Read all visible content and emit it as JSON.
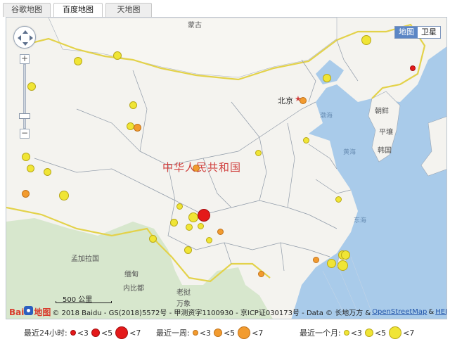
{
  "tabs": [
    {
      "label": "谷歌地图",
      "active": false
    },
    {
      "label": "百度地图",
      "active": true
    },
    {
      "label": "天地图",
      "active": false
    }
  ],
  "map_type": {
    "map_label": "地图",
    "satellite_label": "卫星"
  },
  "labels": {
    "mongolia": "蒙古",
    "china": "中华人民共和国",
    "beijing": "北京",
    "bohai": "渤海",
    "huanghai": "黄海",
    "donghai": "东海",
    "north_korea": "朝鲜",
    "pyongyang": "平壤",
    "korea": "韩国",
    "bangladesh": "孟加拉国",
    "myanmar": "缅甸",
    "naypyidaw": "内比都",
    "laos": "老挝",
    "vientiane": "万象"
  },
  "scale": {
    "text": "500 公里"
  },
  "copyright": {
    "logo_text": "Bai",
    "logo_suffix": "地图",
    "text": "© 2018 Baidu - GS(2018)5572号 - 甲测资字1100930 - 京ICP证030173号 - Data © 长地万方 &",
    "osm": "OpenStreetMap",
    "amp": "&",
    "here": "HERE"
  },
  "legend": {
    "day_label": "最近24小时:",
    "week_label": "最近一周:",
    "month_label": "最近一个月:",
    "lt3": "<3",
    "lt5": "<5",
    "lt7": "<7"
  },
  "colors": {
    "day": "#e4191a",
    "week": "#f29b2f",
    "month": "#f0e535"
  }
}
